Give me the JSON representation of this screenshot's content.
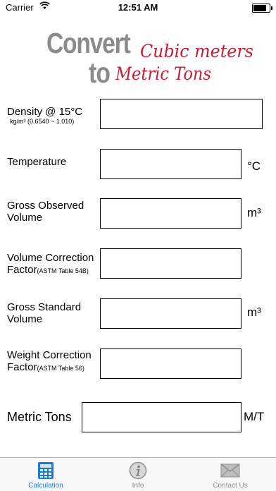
{
  "status_bar": {
    "carrier": "Carrier",
    "time": "12:51 AM",
    "battery_level": 0.9
  },
  "logo": {
    "word1": "Convert",
    "word2": "to",
    "word3": "Cubic meters",
    "word4": "Metric Tons"
  },
  "form": {
    "density": {
      "label": "Density @ 15°C",
      "sub": "kg/m³ (0.6540 ~ 1.010)",
      "value": ""
    },
    "temperature": {
      "label": "Temperature",
      "unit": "°C",
      "value": ""
    },
    "gov": {
      "label_line1": "Gross Observed",
      "label_line2": "Volume",
      "unit": "m³",
      "value": ""
    },
    "vcf": {
      "label_line1": "Volume Correction",
      "label_line2": "Factor",
      "note": "(ASTM Table 54B)",
      "value": ""
    },
    "gsv": {
      "label_line1": "Gross Standard",
      "label_line2": "Volume",
      "unit": "m³",
      "value": ""
    },
    "wcf": {
      "label_line1": "Weight Correction",
      "label_line2": "Factor",
      "note": "(ASTM Table 56)",
      "value": ""
    },
    "metric_tons": {
      "label": "Metric Tons",
      "unit": "M/T",
      "value": ""
    }
  },
  "tab_bar": {
    "tabs": [
      {
        "label": "Calculation",
        "icon": "calculator-icon",
        "active": true
      },
      {
        "label": "Info",
        "icon": "info-icon",
        "active": false
      },
      {
        "label": "Contact Us",
        "icon": "envelope-icon",
        "active": false
      }
    ],
    "active_color": "#1a7bd6",
    "inactive_color": "#8e8e93"
  }
}
